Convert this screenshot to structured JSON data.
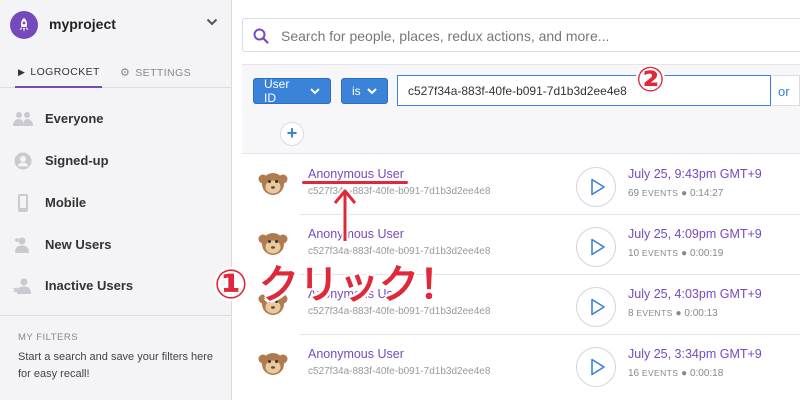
{
  "project": {
    "name": "myproject"
  },
  "tabs": {
    "logrocket": "LOGROCKET",
    "settings": "SETTINGS"
  },
  "sidebar": {
    "items": [
      {
        "label": "Everyone",
        "icon": "people-icon"
      },
      {
        "label": "Signed-up",
        "icon": "user-circle-icon"
      },
      {
        "label": "Mobile",
        "icon": "mobile-icon"
      },
      {
        "label": "New Users",
        "icon": "add-user-icon"
      },
      {
        "label": "Inactive Users",
        "icon": "remove-user-icon"
      }
    ],
    "filters_title": "MY FILTERS",
    "filters_text": "Start a search and save your filters here for easy recall!"
  },
  "search": {
    "placeholder": "Search for people, places, redux actions, and more..."
  },
  "filter": {
    "field_label": "User ID",
    "operator_label": "is",
    "value": "c527f34a-883f-40fe-b091-7d1b3d2ee4e8",
    "or_label": "or",
    "add_label": "+"
  },
  "sessions": [
    {
      "user": "Anonymous User",
      "id": "c527f34a-883f-40fe-b091-7d1b3d2ee4e8",
      "time": "July 25, 9:43pm GMT+9",
      "events": "69",
      "duration": "0:14:27"
    },
    {
      "user": "Anonymous User",
      "id": "c527f34a-883f-40fe-b091-7d1b3d2ee4e8",
      "time": "July 25, 4:09pm GMT+9",
      "events": "10",
      "duration": "0:00:19"
    },
    {
      "user": "Anonymous User",
      "id": "c527f34a-883f-40fe-b091-7d1b3d2ee4e8",
      "time": "July 25, 4:03pm GMT+9",
      "events": "8",
      "duration": "0:00:13"
    },
    {
      "user": "Anonymous User",
      "id": "c527f34a-883f-40fe-b091-7d1b3d2ee4e8",
      "time": "July 25, 3:34pm GMT+9",
      "events": "16",
      "duration": "0:00:18"
    }
  ],
  "events_word": "EVENTS",
  "annotations": {
    "click": "① クリック！",
    "step_two": "②"
  },
  "colors": {
    "accent": "#764abc",
    "primary": "#3b82d9",
    "annotation": "#e0283a"
  }
}
